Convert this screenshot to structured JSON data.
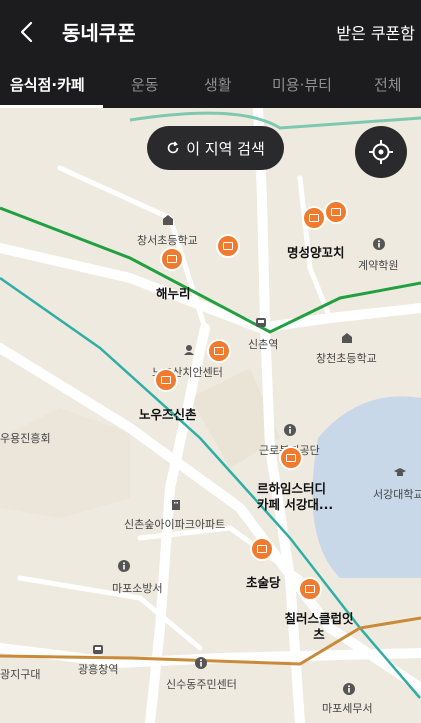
{
  "header": {
    "title": "동네쿠폰",
    "received_label": "받은 쿠폰함"
  },
  "tabs": [
    "음식점·카페",
    "운동",
    "생활",
    "미용·뷰티",
    "전체"
  ],
  "map": {
    "search_button": "이 지역 검색",
    "labels": {
      "school1": "창서초등학교",
      "restaurant1": "명성양꼬치",
      "academy": "계약학원",
      "restaurant2": "해누리",
      "station": "신촌역",
      "school2": "창천초등학교",
      "center": "노고산치안센터",
      "restaurant3": "노우즈신촌",
      "church": "우용진흥회",
      "park": "근로복지공단",
      "restaurant4": "르하임스터디카페 서강대...",
      "university": "서강대학교",
      "apartment": "신촌숲아이파크아파트",
      "fire": "마포소방서",
      "restaurant5": "초술당",
      "restaurant6": "칠러스클럽잇츠",
      "subway": "광흥창역",
      "district": "신수동주민센터",
      "tax": "마포세무서",
      "ward": "광지구대"
    }
  }
}
